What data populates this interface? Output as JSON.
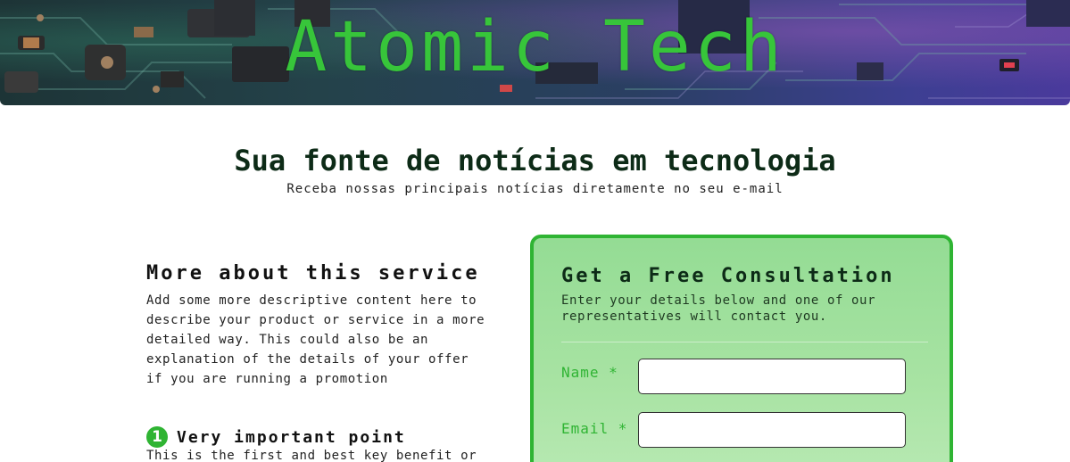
{
  "hero": {
    "title": "Atomic Tech",
    "title_color": "#37c53a"
  },
  "headline": {
    "title": "Sua fonte de notícias em tecnologia",
    "subtitle": "Receba nossas principais notícias diretamente no seu e-mail"
  },
  "about": {
    "title": "More about this service",
    "text": "Add some more descriptive content here to describe your product or service in a more detailed way. This could also be an explanation of the details of your offer if you are running a promotion",
    "points": [
      {
        "number": "1",
        "title": "Very important point",
        "text": "This is the first and best key benefit or"
      }
    ]
  },
  "form": {
    "title": "Get a Free Consultation",
    "description": "Enter your details below and one of our representatives will contact you.",
    "fields": [
      {
        "label": "Name *",
        "value": ""
      },
      {
        "label": "Email *",
        "value": ""
      }
    ]
  },
  "colors": {
    "accent": "#2fb433",
    "card_background": "#a8e3a3",
    "heading": "#0d2b17"
  }
}
